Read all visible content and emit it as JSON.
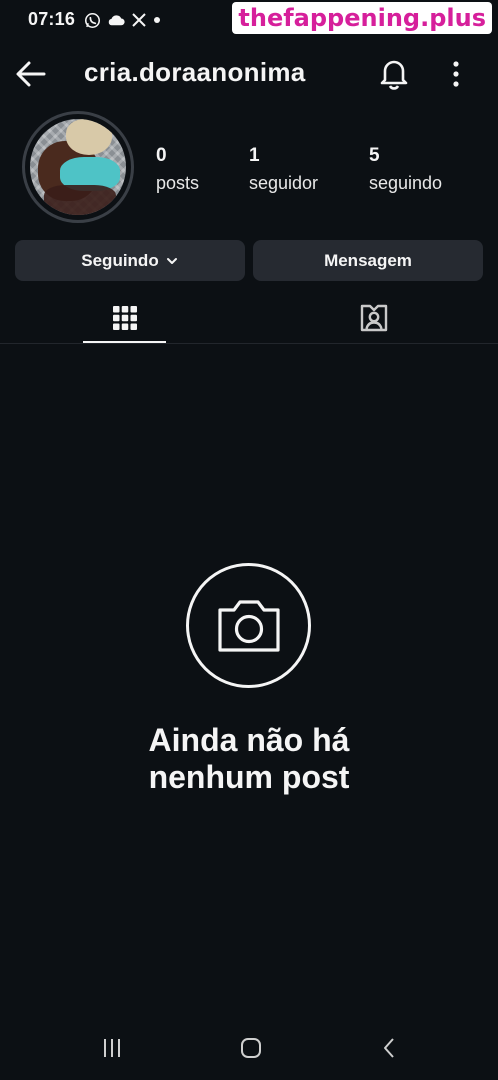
{
  "status_bar": {
    "time": "07:16",
    "icons": [
      "whatsapp-icon",
      "cloud-icon",
      "x-icon",
      "dot-icon"
    ]
  },
  "watermark": "thefappening.plus",
  "header": {
    "username": "cria.doraanonima"
  },
  "profile": {
    "stats": [
      {
        "number": "0",
        "label": "posts"
      },
      {
        "number": "1",
        "label": "seguidor"
      },
      {
        "number": "5",
        "label": "seguindo"
      }
    ]
  },
  "actions": {
    "following_label": "Seguindo",
    "message_label": "Mensagem"
  },
  "tabs": [
    {
      "icon": "grid-icon",
      "active": true
    },
    {
      "icon": "tagged-icon",
      "active": false
    }
  ],
  "empty_state": {
    "line1": "Ainda não há",
    "line2": "nenhum post"
  },
  "nav": [
    "recents-icon",
    "home-icon",
    "back-icon"
  ],
  "colors": {
    "background": "#0c1014",
    "button": "#262a31",
    "text": "#f5f5f5",
    "watermark": "#d61f9b"
  }
}
